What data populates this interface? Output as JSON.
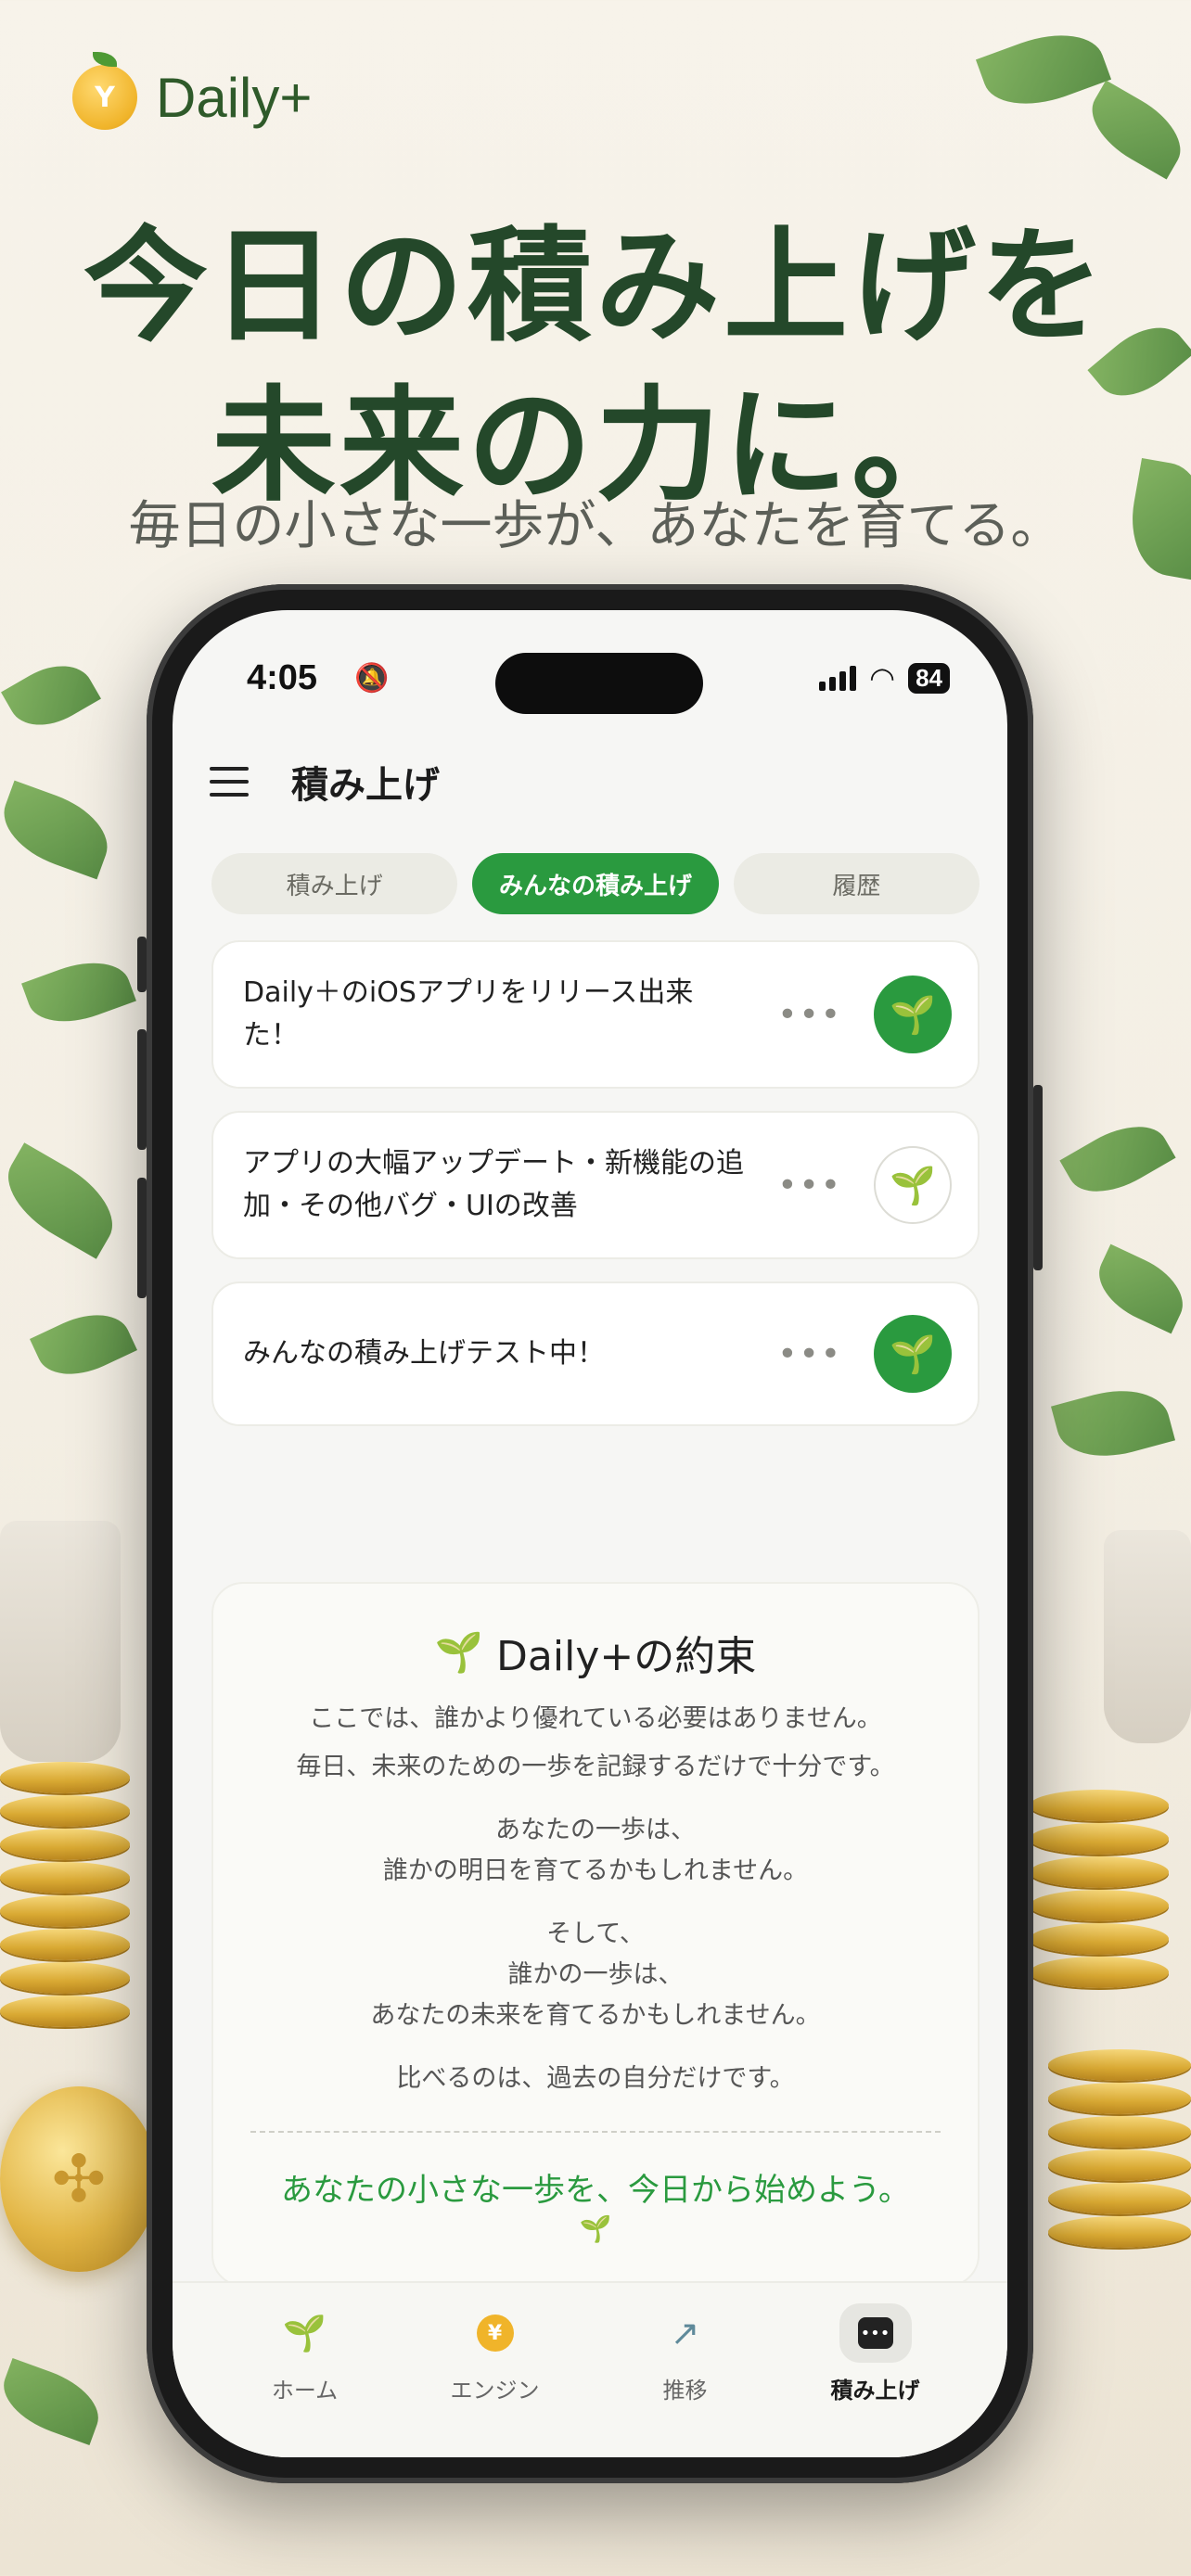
{
  "brand": {
    "name": "Daily+",
    "coin_letter": "Y"
  },
  "hero": {
    "line1": "今日の積み上げを",
    "line2": "未来の力に。",
    "subtitle": "毎日の小さな一歩が、あなたを育てる。"
  },
  "status_bar": {
    "time": "4:05",
    "battery": "84"
  },
  "app_bar": {
    "title": "積み上げ"
  },
  "tabs": [
    {
      "label": "積み上げ",
      "active": false
    },
    {
      "label": "みんなの積み上げ",
      "active": true
    },
    {
      "label": "履歴",
      "active": false
    }
  ],
  "posts": [
    {
      "line1": "Daily＋のiOSアプリをリリース出来",
      "line2": "た！",
      "sprouted": true
    },
    {
      "line1": "アプリの大幅アップデート・新機能の追",
      "line2": "加・その他バグ・UIの改善",
      "sprouted": false
    },
    {
      "line1": "みんなの積み上げテスト中！",
      "line2": "",
      "sprouted": true
    }
  ],
  "promise": {
    "title": "Daily+の約束",
    "p1": "ここでは、誰かより優れている必要はありません。",
    "p2": "毎日、未来のための一歩を記録するだけで十分です。",
    "p3a": "あなたの一歩は、",
    "p3b": "誰かの明日を育てるかもしれません。",
    "p4a": "そして、",
    "p4b": "誰かの一歩は、",
    "p4c": "あなたの未来を育てるかもしれません。",
    "p5": "比べるのは、過去の自分だけです。",
    "closing": "あなたの小さな一歩を、今日から始めよう。"
  },
  "bottom_nav": [
    {
      "label": "ホーム",
      "icon": "sprout-icon",
      "active": false
    },
    {
      "label": "エンジン",
      "icon": "coin-icon",
      "active": false
    },
    {
      "label": "推移",
      "icon": "trend-arrow-icon",
      "active": false
    },
    {
      "label": "積み上げ",
      "icon": "chat-bubble-icon",
      "active": true
    }
  ],
  "colors": {
    "accent": "#2a9a3f",
    "headline": "#24482a",
    "coin": "#f0b42a"
  }
}
